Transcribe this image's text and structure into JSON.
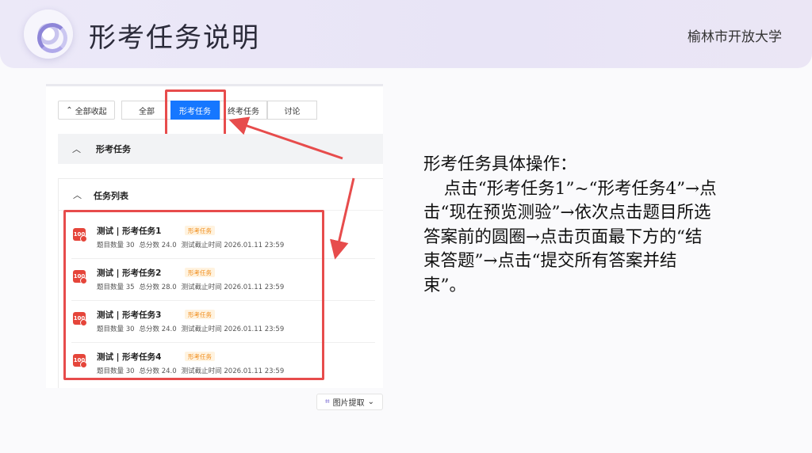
{
  "header": {
    "title": "形考任务说明",
    "school": "榆林市开放大学"
  },
  "toolbar": {
    "collapse_all": "全部收起",
    "tabs": [
      "全部",
      "形考任务",
      "终考任务",
      "讨论"
    ]
  },
  "section_formative": {
    "label": "形考任务"
  },
  "section_tasklist": {
    "label": "任务列表"
  },
  "tasks": [
    {
      "name": "测试 | 形考任务1",
      "tag": "形考任务",
      "count": "题目数量 30",
      "score": "总分数 24.0",
      "deadline": "测试截止时间 2026.01.11 23:59"
    },
    {
      "name": "测试 | 形考任务2",
      "tag": "形考任务",
      "count": "题目数量 35",
      "score": "总分数 28.0",
      "deadline": "测试截止时间 2026.01.11 23:59"
    },
    {
      "name": "测试 | 形考任务3",
      "tag": "形考任务",
      "count": "题目数量 30",
      "score": "总分数 24.0",
      "deadline": "测试截止时间 2026.01.11 23:59"
    },
    {
      "name": "测试 | 形考任务4",
      "tag": "形考任务",
      "count": "题目数量 30",
      "score": "总分数 24.0",
      "deadline": "测试截止时间 2026.01.11 23:59"
    }
  ],
  "picture_extract": {
    "label": "图片提取"
  },
  "instructions": {
    "line1": "形考任务具体操作：",
    "body": "点击“形考任务1”~“形考任务4”→点击“现在预览测验”→依次点击题目所选答案前的圆圈→点击页面最下方的“结束答题”→点击“提交所有答案并结束”。"
  },
  "colors": {
    "accent": "#1677ff",
    "highlight": "#e74c4c",
    "tag_text": "#f08c1a"
  }
}
